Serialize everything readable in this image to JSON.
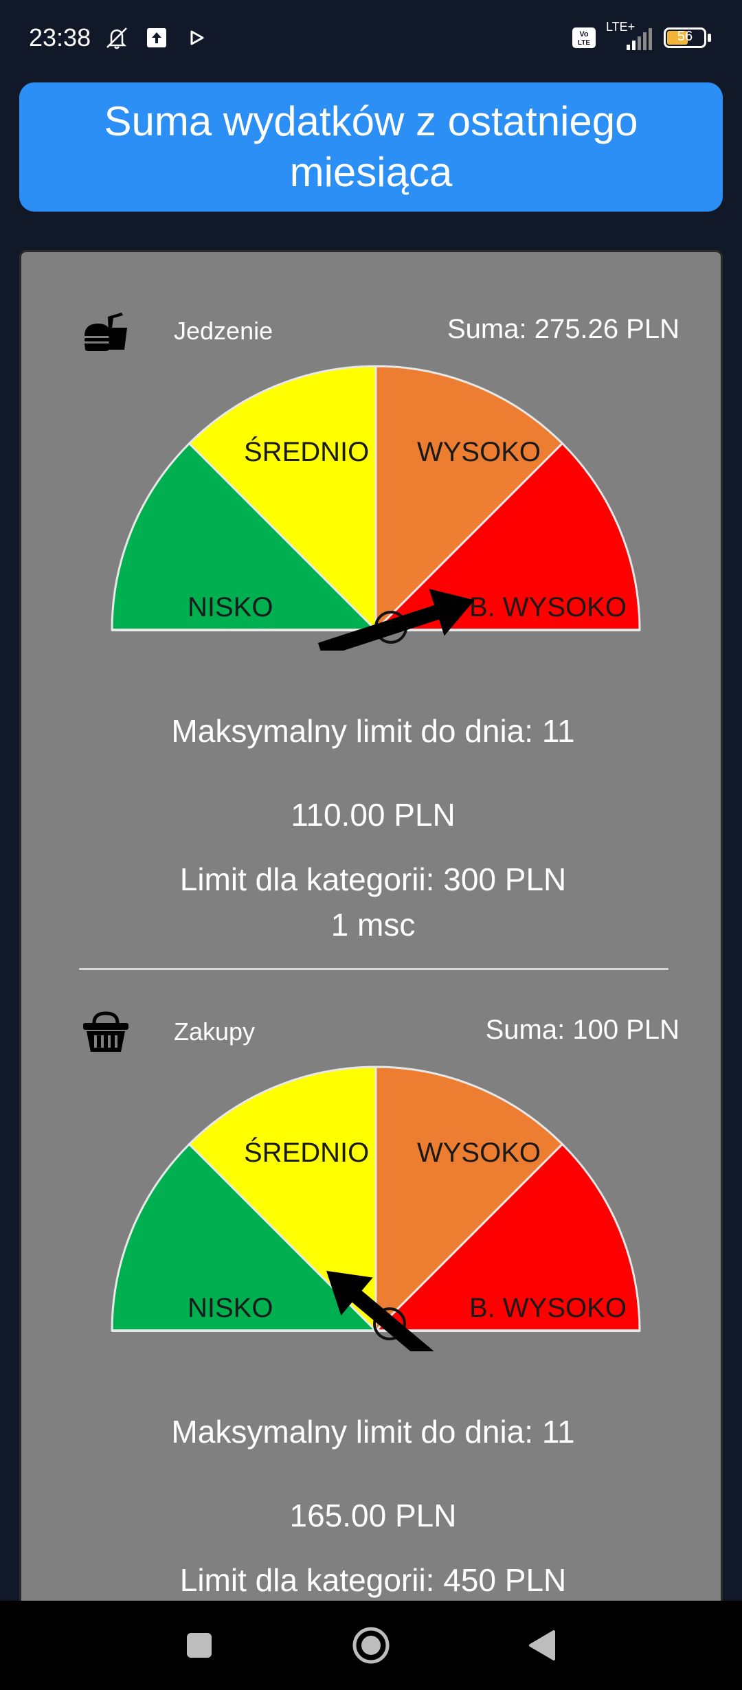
{
  "status_bar": {
    "time": "23:38",
    "icons_left": [
      "mute-icon",
      "upload-icon",
      "play-icon"
    ],
    "network": "LTE+",
    "volte": "Vo LTE",
    "battery": "56"
  },
  "header": {
    "title": "Suma wydatków z ostatniego miesiąca"
  },
  "gauge_labels": {
    "low": "NISKO",
    "medium": "ŚREDNIO",
    "high": "WYSOKO",
    "very_high": "B. WYSOKO"
  },
  "categories": [
    {
      "name": "Jedzenie",
      "icon": "fastfood-icon",
      "sum": "Suma: 275.26 PLN",
      "needle_level": "B. WYSOKO",
      "max_limit_label": "Maksymalny limit do dnia: 11",
      "max_limit_value": "110.00 PLN",
      "category_limit": "Limit dla kategorii: 300 PLN",
      "period": "1 msc"
    },
    {
      "name": "Zakupy",
      "icon": "basket-icon",
      "sum": "Suma: 100 PLN",
      "needle_level": "ŚREDNIO",
      "max_limit_label": "Maksymalny limit do dnia: 11",
      "max_limit_value": "165.00 PLN",
      "category_limit": "Limit dla kategorii: 450 PLN",
      "period": ""
    }
  ],
  "colors": {
    "banner": "#2b8ff5",
    "card": "#808080",
    "low": "#00b050",
    "medium": "#ffff00",
    "high": "#ed7d31",
    "very_high": "#ff0000"
  }
}
